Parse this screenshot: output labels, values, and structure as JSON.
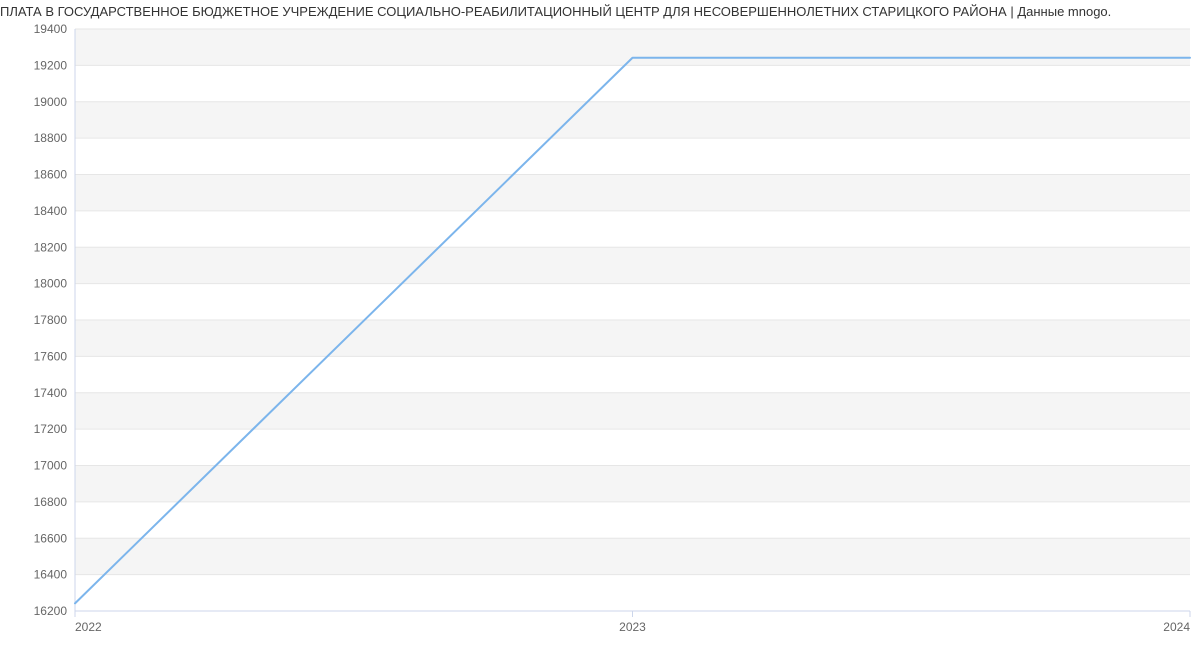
{
  "title": "ПЛАТА В ГОСУДАРСТВЕННОЕ БЮДЖЕТНОЕ УЧРЕЖДЕНИЕ СОЦИАЛЬНО-РЕАБИЛИТАЦИОННЫЙ ЦЕНТР ДЛЯ НЕСОВЕРШЕННОЛЕТНИХ СТАРИЦКОГО РАЙОНА | Данные mnogo.",
  "chart_data": {
    "type": "line",
    "x": [
      2022,
      2023,
      2024
    ],
    "values": [
      16242,
      19242,
      19242
    ],
    "title": "ПЛАТА В ГОСУДАРСТВЕННОЕ БЮДЖЕТНОЕ УЧРЕЖДЕНИЕ СОЦИАЛЬНО-РЕАБИЛИТАЦИОННЫЙ ЦЕНТР ДЛЯ НЕСОВЕРШЕННОЛЕТНИХ СТАРИЦКОГО РАЙОНА | Данные mnogo.",
    "xlabel": "",
    "ylabel": "",
    "xlim": [
      2022,
      2024
    ],
    "ylim": [
      16200,
      19400
    ],
    "x_ticks": [
      2022,
      2023,
      2024
    ],
    "y_ticks": [
      16200,
      16400,
      16600,
      16800,
      17000,
      17200,
      17400,
      17600,
      17800,
      18000,
      18200,
      18400,
      18600,
      18800,
      19000,
      19200,
      19400
    ],
    "grid": true
  },
  "colors": {
    "line": "#7cb5ec",
    "band": "#f5f5f5",
    "axis": "#ccd6eb"
  }
}
